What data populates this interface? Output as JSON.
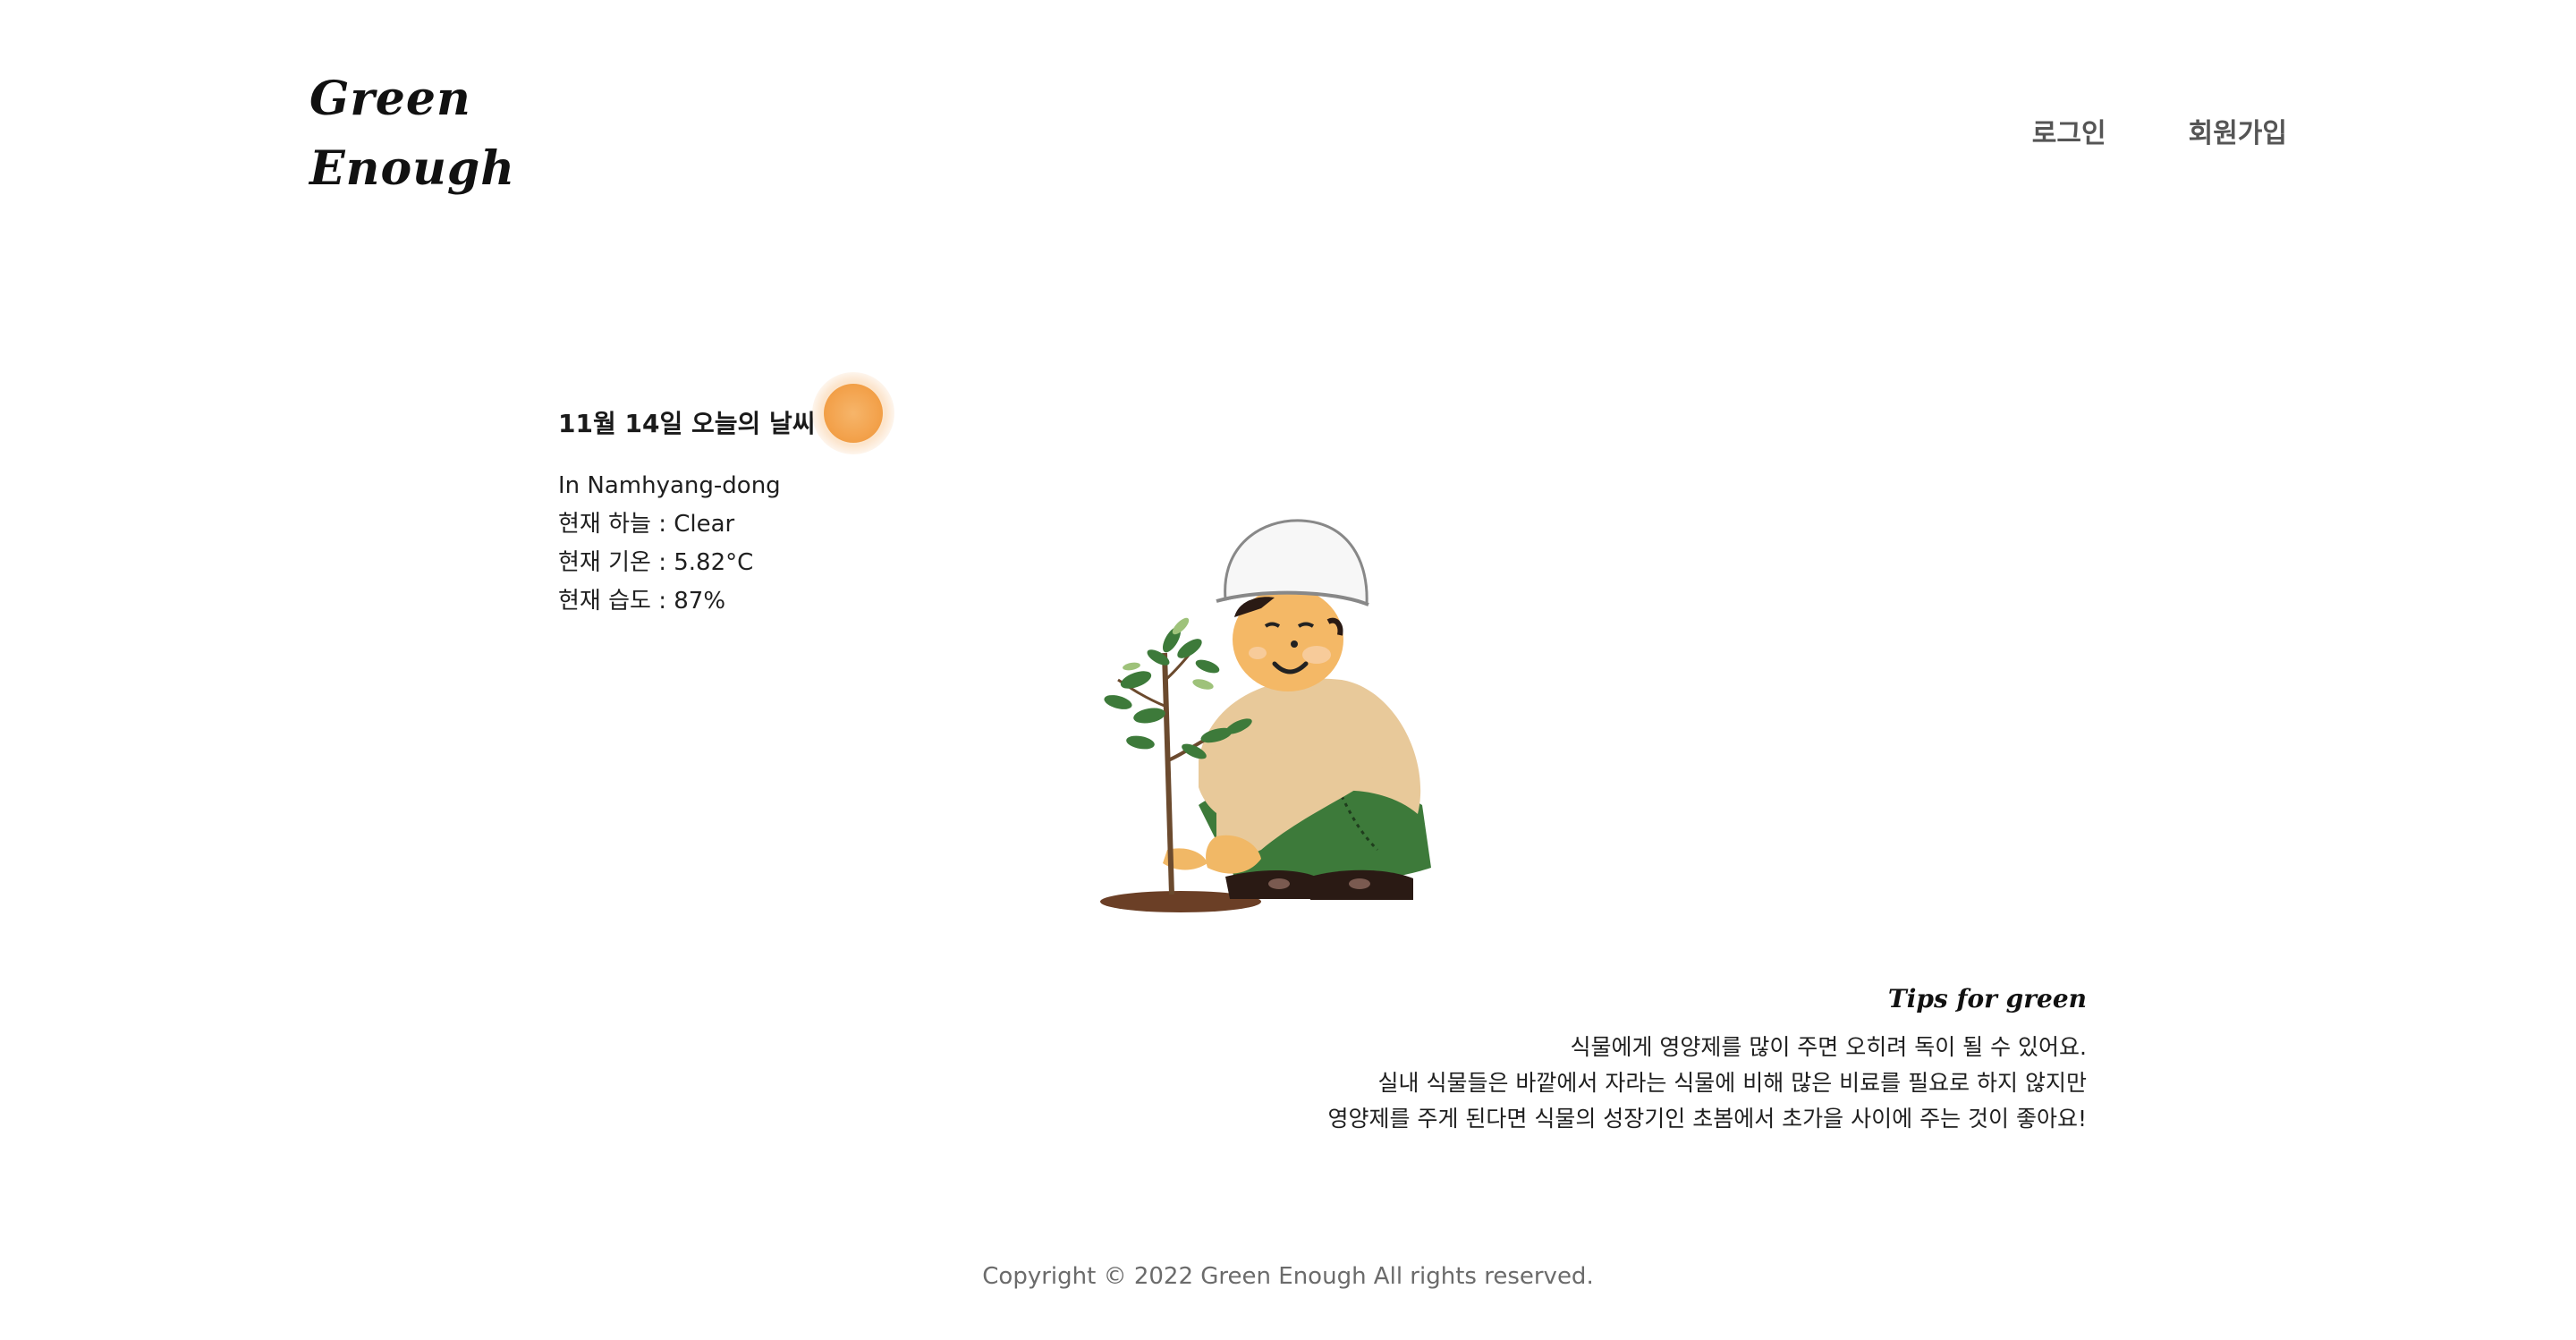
{
  "header": {
    "logo_line1": "Green",
    "logo_line2": "Enough",
    "nav": {
      "login": "로그인",
      "signup": "회원가입"
    }
  },
  "weather": {
    "title": "11월 14일 오늘의 날씨",
    "icon": "sun-icon",
    "location": "In Namhyang-dong",
    "sky": "현재 하늘 : Clear",
    "temperature": "현재 기온 : 5.82°C",
    "humidity": "현재 습도 : 87%"
  },
  "illustration": {
    "icon": "gardener-planting-tree-illustration"
  },
  "tips": {
    "title": "Tips for green",
    "line1": "식물에게 영양제를 많이 주면 오히려 독이 될 수 있어요.",
    "line2": "실내 식물들은 바깥에서 자라는 식물에 비해 많은 비료를 필요로 하지 않지만",
    "line3": "영양제를 주게 된다면 식물의 성장기인 초봄에서 초가을 사이에 주는 것이 좋아요!"
  },
  "footer": {
    "copyright": "Copyright © 2022 Green Enough All rights reserved."
  },
  "colors": {
    "background": "#ffffff",
    "text": "#1a1a1a",
    "nav_text": "#555555",
    "sun": "#f3a24c",
    "footer_text": "#6b6b6b"
  }
}
